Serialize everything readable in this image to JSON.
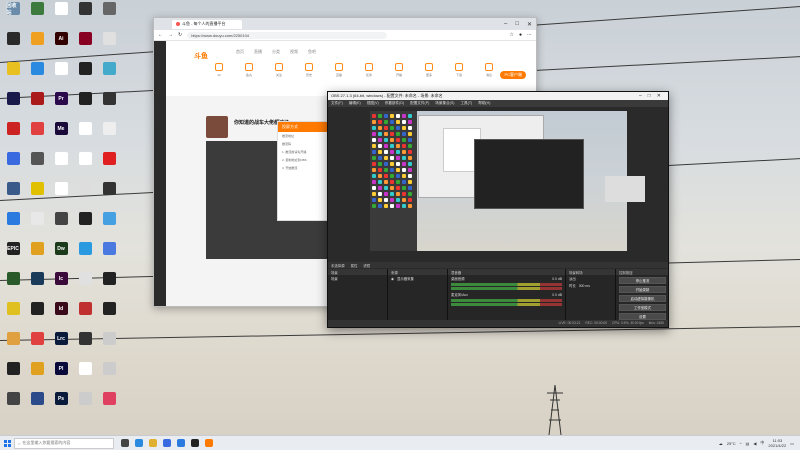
{
  "desktop": {
    "icons": [
      {
        "label": "回收站",
        "color": "#6a8caa"
      },
      {
        "label": "",
        "color": "#3d7a3d"
      },
      {
        "label": "",
        "color": "#ffffff"
      },
      {
        "label": "",
        "color": "#333333"
      },
      {
        "label": "",
        "color": "#666666"
      },
      {
        "label": "",
        "color": "#2a2a2a"
      },
      {
        "label": "",
        "color": "#f0a020"
      },
      {
        "label": "Ai",
        "color": "#330000"
      },
      {
        "label": "",
        "color": "#880022"
      },
      {
        "label": "",
        "color": "#e0e0e0"
      },
      {
        "label": "",
        "color": "#e8c020"
      },
      {
        "label": "",
        "color": "#2a8ae0"
      },
      {
        "label": "",
        "color": "#ffffff"
      },
      {
        "label": "",
        "color": "#222222"
      },
      {
        "label": "",
        "color": "#44aacc"
      },
      {
        "label": "",
        "color": "#1a1a4a"
      },
      {
        "label": "",
        "color": "#aa1a1a"
      },
      {
        "label": "Pr",
        "color": "#2a0a4a"
      },
      {
        "label": "",
        "color": "#222222"
      },
      {
        "label": "",
        "color": "#333333"
      },
      {
        "label": "",
        "color": "#cc2222"
      },
      {
        "label": "",
        "color": "#e04040"
      },
      {
        "label": "Me",
        "color": "#1a0a3a"
      },
      {
        "label": "",
        "color": "#ffffff"
      },
      {
        "label": "",
        "color": "#eeeeee"
      },
      {
        "label": "",
        "color": "#3a6ae0"
      },
      {
        "label": "",
        "color": "#555555"
      },
      {
        "label": "",
        "color": "#ffffff"
      },
      {
        "label": "",
        "color": "#ffffff"
      },
      {
        "label": "",
        "color": "#e02020"
      },
      {
        "label": "",
        "color": "#3a5a8a"
      },
      {
        "label": "",
        "color": "#e0c000"
      },
      {
        "label": "",
        "color": "#ffffff"
      },
      {
        "label": "",
        "color": "#dddddd"
      },
      {
        "label": "",
        "color": "#333333"
      },
      {
        "label": "",
        "color": "#2a7ae0"
      },
      {
        "label": "",
        "color": "#e8e8e8"
      },
      {
        "label": "",
        "color": "#444444"
      },
      {
        "label": "",
        "color": "#222222"
      },
      {
        "label": "",
        "color": "#44a0e0"
      },
      {
        "label": "EPIC",
        "color": "#222222"
      },
      {
        "label": "",
        "color": "#e0a020"
      },
      {
        "label": "Dw",
        "color": "#1a3a1a"
      },
      {
        "label": "",
        "color": "#2a9ae0"
      },
      {
        "label": "",
        "color": "#4a7ae0"
      },
      {
        "label": "",
        "color": "#2a5a2a"
      },
      {
        "label": "",
        "color": "#1a3a5a"
      },
      {
        "label": "Ic",
        "color": "#3a0a3a"
      },
      {
        "label": "",
        "color": "#e0e0e0"
      },
      {
        "label": "",
        "color": "#222222"
      },
      {
        "label": "",
        "color": "#e0c020"
      },
      {
        "label": "",
        "color": "#222222"
      },
      {
        "label": "Id",
        "color": "#3a0a1a"
      },
      {
        "label": "",
        "color": "#c03030"
      },
      {
        "label": "",
        "color": "#222222"
      },
      {
        "label": "",
        "color": "#e0a040"
      },
      {
        "label": "",
        "color": "#e04040"
      },
      {
        "label": "Lrc",
        "color": "#0a1a3a"
      },
      {
        "label": "",
        "color": "#333333"
      },
      {
        "label": "",
        "color": "#cccccc"
      },
      {
        "label": "",
        "color": "#222222"
      },
      {
        "label": "",
        "color": "#e0a020"
      },
      {
        "label": "Pl",
        "color": "#0a0a3a"
      },
      {
        "label": "",
        "color": "#ffffff"
      },
      {
        "label": "",
        "color": "#cccccc"
      },
      {
        "label": "",
        "color": "#444444"
      },
      {
        "label": "",
        "color": "#2a4a8a"
      },
      {
        "label": "Ps",
        "color": "#0a1a3a"
      },
      {
        "label": "",
        "color": "#cccccc"
      },
      {
        "label": "",
        "color": "#e04060"
      }
    ]
  },
  "browser": {
    "tab_title": "斗鱼 - 每个人的直播平台",
    "url": "https://www.douyu.com/2250104",
    "site_logo": "斗鱼",
    "nav_items": [
      "首页",
      "直播",
      "分类",
      "视频",
      "鱼吧"
    ],
    "room_title": "你知道的战车大佬都过了~",
    "top_icons": [
      {
        "label": "12"
      },
      {
        "label": "鱼丸"
      },
      {
        "label": "关注"
      },
      {
        "label": "历史"
      },
      {
        "label": "直播"
      },
      {
        "label": "任务"
      },
      {
        "label": "开播"
      },
      {
        "label": "更多"
      },
      {
        "label": "下载"
      },
      {
        "label": "消息"
      }
    ],
    "cta_label": "PC客户端",
    "dialog": {
      "title": "投屏方式",
      "lines": [
        "推流地址",
        "推流码",
        "1. 推流前请先开播",
        "2. 复制地址到OBS",
        "3. 开始推流"
      ]
    }
  },
  "obs": {
    "title": "OBS 27.1.3 (64-bit, windows) - 配置文件: 未命名 - 场景: 未命名",
    "menu": [
      "文件(F)",
      "编辑(E)",
      "视图(V)",
      "停靠部件(D)",
      "配置文件(P)",
      "场景集合(S)",
      "工具(T)",
      "帮助(H)"
    ],
    "bar_labels": [
      "未选择源",
      "属性",
      "滤镜"
    ],
    "scenes_title": "场景",
    "scene_items": [
      "场景"
    ],
    "sources_title": "来源",
    "source_items": [
      "显示器采集"
    ],
    "mixer_title": "混音器",
    "mixer_items": [
      {
        "name": "桌面音频",
        "db": "0.0 dB"
      },
      {
        "name": "麦克风/Aux",
        "db": "0.0 dB"
      }
    ],
    "transitions_title": "场景转场",
    "transition_fields": [
      {
        "label": "淡出",
        "value": ""
      },
      {
        "label": "时长",
        "value": "300 ms"
      }
    ],
    "controls_title": "控制按钮",
    "controls": [
      "停止推流",
      "开始录制",
      "启动虚拟摄像机",
      "工作室模式",
      "设置",
      "退出"
    ],
    "status": [
      "LIVE: 00:03:21",
      "REC: 00:00:00",
      "CPU: 3.5%, 30.00 fps",
      "kb/s: 2450"
    ]
  },
  "taskbar": {
    "search_placeholder": "在这里输入你要搜索的内容",
    "tray": {
      "weather": "25°C",
      "clock_time": "11:03",
      "clock_date": "2021/4/22"
    },
    "apps": [
      {
        "name": "task-view",
        "color": "#444444"
      },
      {
        "name": "edge",
        "color": "#2a8ae0"
      },
      {
        "name": "explorer",
        "color": "#e0b030"
      },
      {
        "name": "store",
        "color": "#3a6ae0"
      },
      {
        "name": "mail",
        "color": "#2a7ae0"
      },
      {
        "name": "obs",
        "color": "#222222"
      },
      {
        "name": "douyu",
        "color": "#ff7a00"
      }
    ]
  }
}
